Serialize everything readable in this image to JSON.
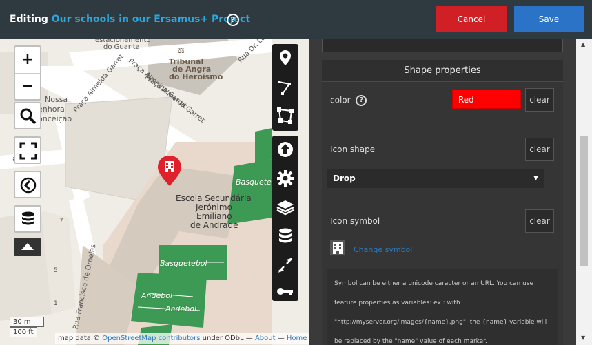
{
  "header": {
    "editing_label": "Editing",
    "map_name": "Our schools in our Ersamus+ Project",
    "help_glyph": "?",
    "cancel_label": "Cancel",
    "save_label": "Save"
  },
  "map": {
    "labels": {
      "parking": "estacionamento",
      "guarita": "do Guarita",
      "tribunal_1": "Tribunal",
      "tribunal_2": "de Angra",
      "tribunal_3": "do Heroísmo",
      "rua_lu": "Rua Dr. Lu",
      "praca_1": "Praça Almeida Garret",
      "praca_2": "Praça Almeida Garret",
      "praca_3": "Praça Almeida Garret",
      "nossa_1": "Nossa",
      "nossa_2": "enhora",
      "nossa_3": "onceição",
      "arret": "arret",
      "school_1": "Escola Secundária",
      "school_2": "Jerónimo",
      "school_3": "Emiliano",
      "school_4": "de Andrade",
      "basket_1": "Basquetebol",
      "basket_2": "Basquetebol",
      "andebol_1": "Andebol",
      "andebol_2": "Andebol",
      "ornelas": "Rua Francisco de Ornelas",
      "num_7": "7",
      "num_5": "5",
      "num_1": "1"
    },
    "zoom_in": "+",
    "zoom_out": "−",
    "scale_m": "30 m",
    "scale_ft": "100 ft",
    "attribution": {
      "prefix": "map data © ",
      "osm_link": "OpenStreetMap contributors",
      "middle": " under ODbL — ",
      "about_link": "About",
      "dash": " — ",
      "home_link": "Home"
    }
  },
  "panel": {
    "section_title": "Shape properties",
    "color_label": "color",
    "color_help": "?",
    "color_value": "Red",
    "clear_label": "clear",
    "icon_shape_label": "Icon shape",
    "icon_shape_value": "Drop",
    "icon_symbol_label": "Icon symbol",
    "change_symbol": "Change symbol",
    "help_text": "Symbol can be either a unicode caracter or an URL. You can use feature properties as variables: ex.: with \"http://myserver.org/images/{name}.png\", the {name} variable will be replaced by the \"name\" value of each marker."
  },
  "colors": {
    "topbar": "#2e3a3f",
    "map_name": "#2aa8e0",
    "cancel": "#d11f26",
    "save": "#2b73c7",
    "color_swatch": "#ff0000",
    "marker": "#e0202a"
  }
}
